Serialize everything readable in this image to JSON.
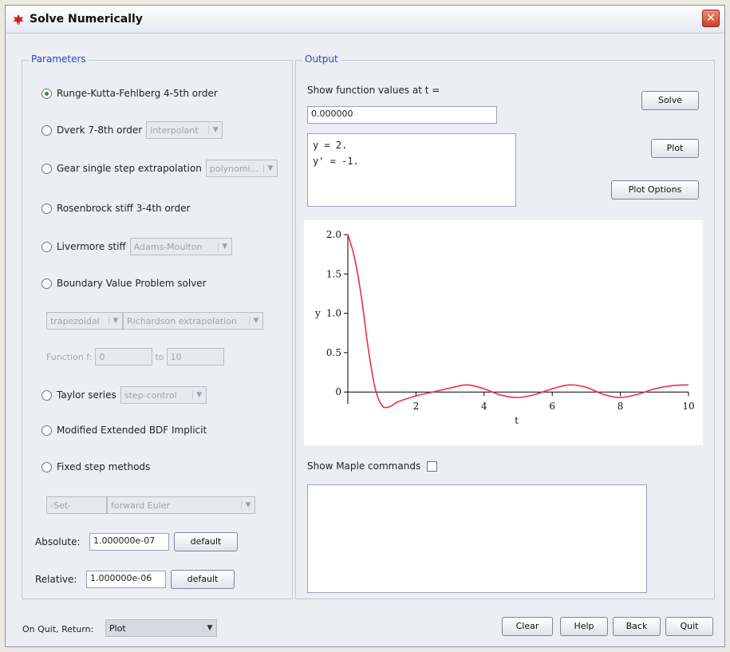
{
  "window": {
    "title": "Solve Numerically"
  },
  "parameters": {
    "legend": "Parameters",
    "methods": [
      {
        "label": "Runge-Kutta-Fehlberg 4-5th order",
        "checked": true
      },
      {
        "label": "Dverk 7-8th order",
        "combo": "interpolant"
      },
      {
        "label": "Gear single step extrapolation",
        "combo": "polynomi..."
      },
      {
        "label": "Rosenbrock stiff 3-4th order"
      },
      {
        "label": "Livermore stiff",
        "combo": "Adams-Moulton"
      },
      {
        "label": "Boundary Value Problem solver"
      },
      {
        "label": "Taylor series",
        "combo": "step-control"
      },
      {
        "label": "Modified Extended BDF Implicit"
      },
      {
        "label": "Fixed step methods"
      }
    ],
    "bvp": {
      "combo1": "trapezoidal",
      "combo2": "Richardson extrapolation",
      "range_label": "Function f:",
      "from": "0",
      "to_label": "to",
      "to": "10"
    },
    "fixed": {
      "combo1": "-Set-",
      "combo2": "forward Euler"
    },
    "absolute": {
      "label": "Absolute:",
      "value": "1.000000e-07",
      "button": "default"
    },
    "relative": {
      "label": "Relative:",
      "value": "1.000000e-06",
      "button": "default"
    }
  },
  "output": {
    "legend": "Output",
    "show_values_label": "Show function values at t =",
    "t_value": "0.000000",
    "results": [
      "y = 2.",
      "y' = -1."
    ],
    "buttons": {
      "solve": "Solve",
      "plot": "Plot",
      "plot_options": "Plot Options"
    },
    "show_maple_label": "Show Maple commands"
  },
  "footer": {
    "on_quit_label": "On Quit, Return:",
    "on_quit_value": "Plot",
    "buttons": {
      "clear": "Clear",
      "help": "Help",
      "back": "Back",
      "quit": "Quit"
    }
  },
  "chart_data": {
    "type": "line",
    "xlabel": "t",
    "ylabel": "y",
    "xlim": [
      0,
      10
    ],
    "ylim": [
      -0.15,
      2.0
    ],
    "xticks": [
      "2",
      "4",
      "6",
      "8",
      "10"
    ],
    "yticks": [
      "0",
      "0.5",
      "1.0",
      "1.5",
      "2.0"
    ],
    "series": [
      {
        "color": "#e8323c",
        "x": [
          0,
          0.2,
          0.4,
          0.6,
          0.8,
          1.0,
          1.2,
          1.5,
          2.0,
          2.5,
          3.0,
          3.5,
          4.0,
          4.5,
          5.0,
          5.5,
          6.0,
          6.5,
          7.0,
          7.5,
          8.0,
          8.5,
          9.0,
          9.5,
          10.0
        ],
        "y": [
          2.0,
          1.7,
          1.2,
          0.55,
          0.05,
          -0.17,
          -0.19,
          -0.12,
          -0.05,
          0.0,
          0.05,
          0.09,
          0.04,
          -0.04,
          -0.07,
          -0.03,
          0.04,
          0.09,
          0.06,
          -0.03,
          -0.07,
          -0.03,
          0.04,
          0.08,
          0.09
        ]
      }
    ]
  },
  "colors": {
    "accent": "#2a46c4",
    "curve": "#e8323c",
    "window_bg": "#eceef4"
  },
  "icons": {
    "app": "maple-leaf-icon",
    "close": "close-icon",
    "dropdown": "chevron-down-icon"
  }
}
